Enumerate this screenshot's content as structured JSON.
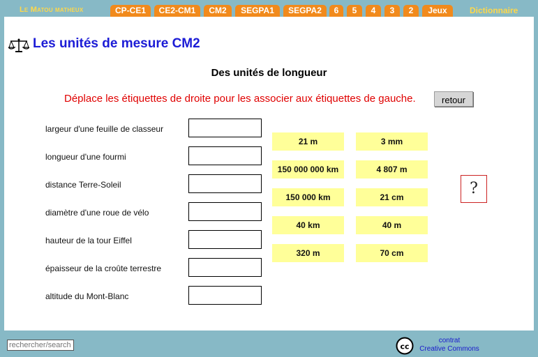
{
  "nav": {
    "brand": "Le Matou matheux",
    "tabs": [
      "CP-CE1",
      "CE2-CM1",
      "CM2",
      "SEGPA1",
      "SEGPA2",
      "6",
      "5",
      "4",
      "3",
      "2",
      "Jeux"
    ],
    "dictionary": "Dictionnaire"
  },
  "header": {
    "title": "Les unités de mesure CM2",
    "subtitle": "Des unités de longueur",
    "instruction": "Déplace les étiquettes de droite pour les associer aux étiquettes de gauche.",
    "retour": "retour"
  },
  "items": [
    "largeur d'une feuille de classeur",
    "longueur d'une fourmi",
    "distance Terre-Soleil",
    "diamètre d'une roue de vélo",
    "hauteur de la tour Eiffel",
    "épaisseur de la croûte terrestre",
    "altitude du Mont-Blanc"
  ],
  "tags": [
    [
      "21 m",
      "3 mm"
    ],
    [
      "150 000 000 km",
      "4 807 m"
    ],
    [
      "150 000 km",
      "21 cm"
    ],
    [
      "40 km",
      "40 m"
    ],
    [
      "320 m",
      "70 cm"
    ]
  ],
  "help": "?",
  "footer": {
    "search_placeholder": "rechercher/search",
    "cc_line1": "contrat",
    "cc_line2": "Creative Commons"
  },
  "colors": {
    "background": "#87b9c6",
    "tab": "#f18a1c",
    "brand": "#ffd84a",
    "title": "#1c1cd6",
    "instruction": "#e00000",
    "tag": "#ffff99"
  }
}
